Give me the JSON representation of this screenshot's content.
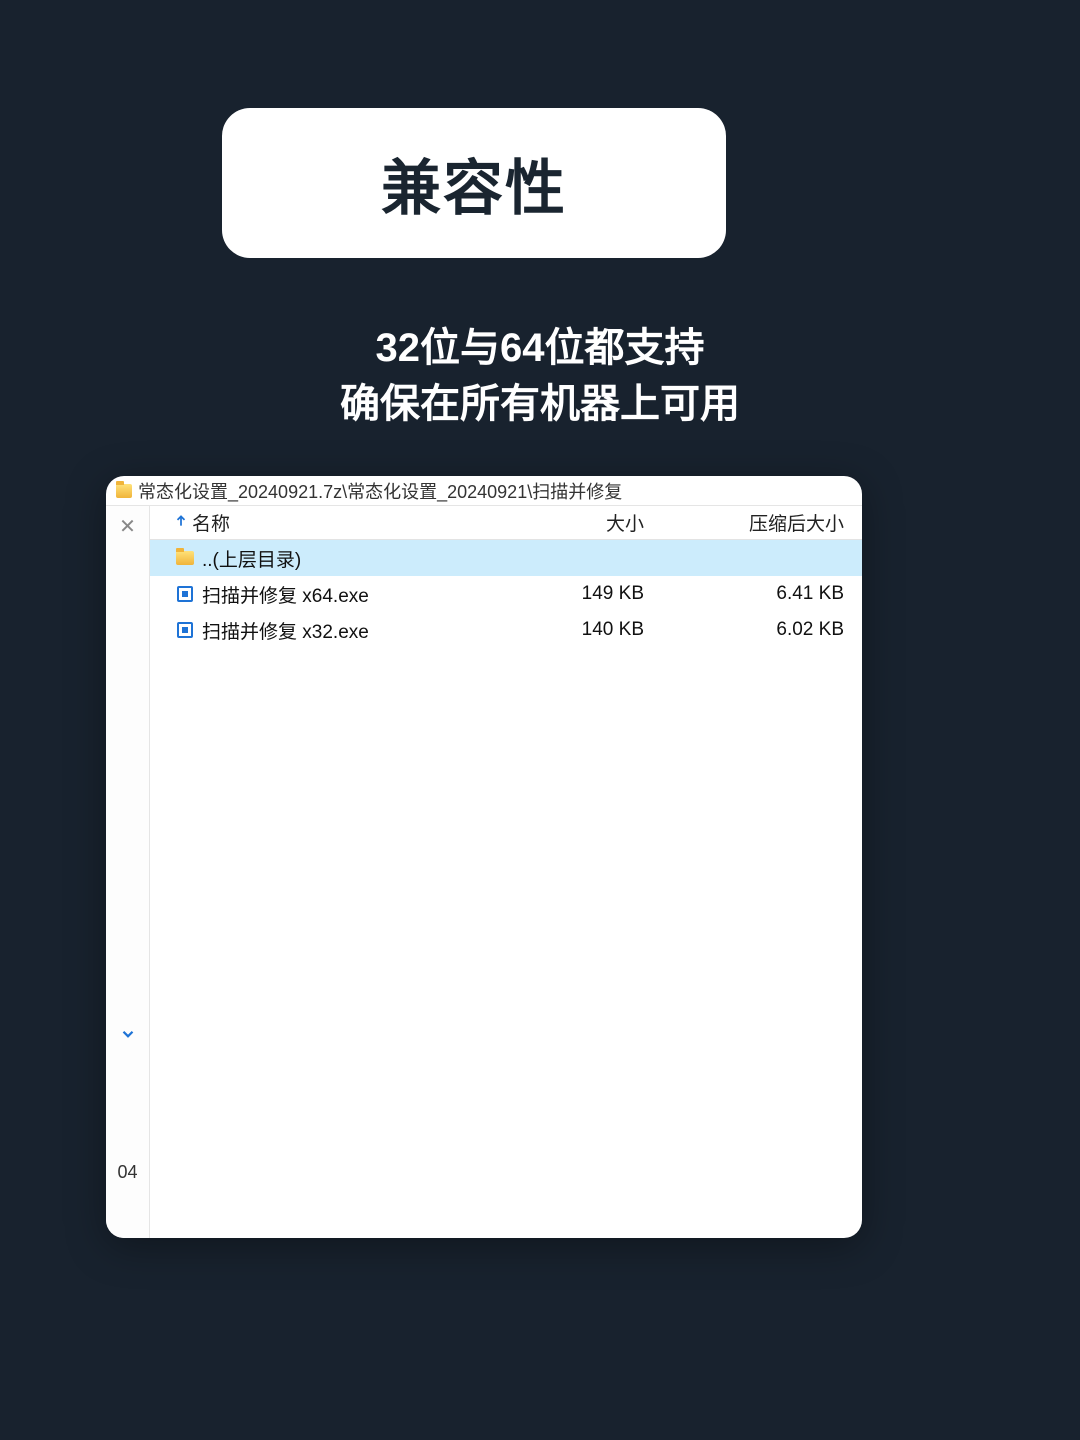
{
  "title": "兼容性",
  "subtitle_line1": "32位与64位都支持",
  "subtitle_line2": "确保在所有机器上可用",
  "explorer": {
    "path": "常态化设置_20240921.7z\\常态化设置_20240921\\扫描并修复",
    "side_close": "✕",
    "side_text": "04",
    "columns": {
      "name": "名称",
      "size": "大小",
      "compressed_size": "压缩后大小"
    },
    "rows": [
      {
        "type": "folder",
        "name": "..(上层目录)",
        "size": "",
        "csize": "",
        "selected": true
      },
      {
        "type": "exe",
        "name": "扫描并修复 x64.exe",
        "size": "149 KB",
        "csize": "6.41 KB",
        "selected": false
      },
      {
        "type": "exe",
        "name": "扫描并修复 x32.exe",
        "size": "140 KB",
        "csize": "6.02 KB",
        "selected": false
      }
    ]
  }
}
